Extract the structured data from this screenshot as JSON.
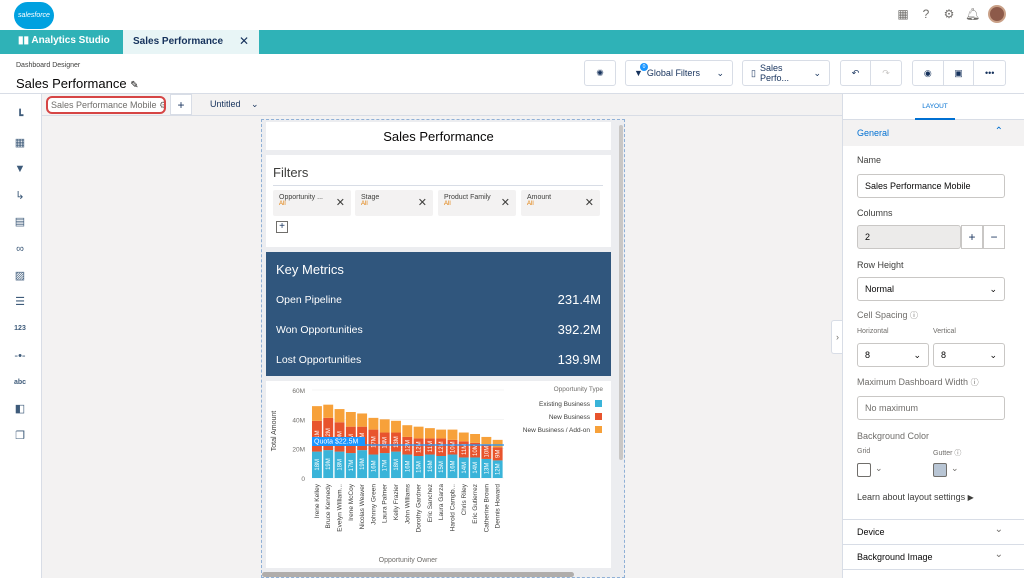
{
  "topbar": {
    "brand": "salesforce"
  },
  "appbar": {
    "app_name": "Analytics Studio",
    "tab_label": "Sales Performance"
  },
  "header": {
    "subtitle": "Dashboard Designer",
    "title": "Sales Performance",
    "global_filters_label": "Global Filters",
    "global_filters_count": "0",
    "device_label": "Sales Perfo..."
  },
  "tabs": {
    "layout_name": "Sales Performance Mobile",
    "page_tab": "Untitled"
  },
  "dashboard": {
    "title": "Sales Performance",
    "filters_heading": "Filters",
    "filters": [
      {
        "label": "Opportunity ...",
        "value": "All"
      },
      {
        "label": "Stage",
        "value": "All"
      },
      {
        "label": "Product Family",
        "value": "All"
      },
      {
        "label": "Amount",
        "value": "All"
      }
    ],
    "metrics_heading": "Key Metrics",
    "metrics": [
      {
        "label": "Open Pipeline",
        "value": "231.4M"
      },
      {
        "label": "Won Opportunities",
        "value": "392.2M"
      },
      {
        "label": "Lost Opportunities",
        "value": "139.9M"
      }
    ]
  },
  "chart_data": {
    "type": "bar",
    "stacked": true,
    "ylabel": "Total Amount",
    "xlabel": "Opportunity Owner",
    "legend_title": "Opportunity Type",
    "legend_position": "top-right",
    "yticks": [
      "60M",
      "40M",
      "20M",
      "0"
    ],
    "ylim": [
      0,
      60
    ],
    "reference_line": {
      "label": "Quota $22.5M",
      "value": 22.5
    },
    "categories": [
      "Irene Kelley",
      "Bruce Kennedy",
      "Evelyn William...",
      "Irene McCoy",
      "Nicolas Weaver",
      "Johnny Green",
      "Laura Palmer",
      "Kelly Frazier",
      "John Williams",
      "Dorothy Gardner",
      "Eric Sanchez",
      "Laura Garza",
      "Harold Campb...",
      "Chris Riley",
      "Eric Gutierrez",
      "Catherine Brown",
      "Dennis Howard"
    ],
    "series": [
      {
        "name": "Existing Business",
        "color": "#3ab4d9",
        "values": [
          18,
          19,
          18,
          17,
          19,
          16,
          17,
          18,
          16,
          15,
          16,
          15,
          16,
          14,
          14,
          13,
          12
        ]
      },
      {
        "name": "New Business",
        "color": "#e8542d",
        "values": [
          21,
          22,
          20,
          18,
          16,
          17,
          14,
          13,
          12,
          12,
          11,
          12,
          10,
          11,
          10,
          10,
          9
        ]
      },
      {
        "name": "New Business / Add-on",
        "color": "#f7a13a",
        "values": [
          10,
          9,
          9,
          10,
          9,
          8,
          9,
          8,
          8,
          8,
          7,
          6,
          7,
          6,
          6,
          5,
          5
        ]
      }
    ],
    "bar_labels": [
      "21M",
      "22M",
      "20M",
      "18M",
      "16M",
      "17M",
      "14M",
      "13M",
      "12M",
      "12M",
      "11M",
      "12M",
      "10M",
      "11M",
      "10M",
      "10M",
      "9M"
    ],
    "bar_labels_low": [
      "18M",
      "19M",
      "18M",
      "17M",
      "19M",
      "16M",
      "17M",
      "18M",
      "16M",
      "15M",
      "16M",
      "15M",
      "16M",
      "14M",
      "14M",
      "13M",
      "12M"
    ]
  },
  "right_panel": {
    "tab": "LAYOUT",
    "general": "General",
    "name_label": "Name",
    "name_value": "Sales Performance Mobile",
    "columns_label": "Columns",
    "columns_value": "2",
    "row_height_label": "Row Height",
    "row_height_value": "Normal",
    "cell_spacing_label": "Cell Spacing",
    "horizontal_label": "Horizontal",
    "horizontal_value": "8",
    "vertical_label": "Vertical",
    "vertical_value": "8",
    "max_width_label": "Maximum Dashboard Width",
    "max_width_placeholder": "No maximum",
    "bg_color_label": "Background Color",
    "grid_label": "Grid",
    "gutter_label": "Gutter",
    "learn_link": "Learn about layout settings",
    "device_section": "Device",
    "bg_image_section": "Background Image"
  }
}
